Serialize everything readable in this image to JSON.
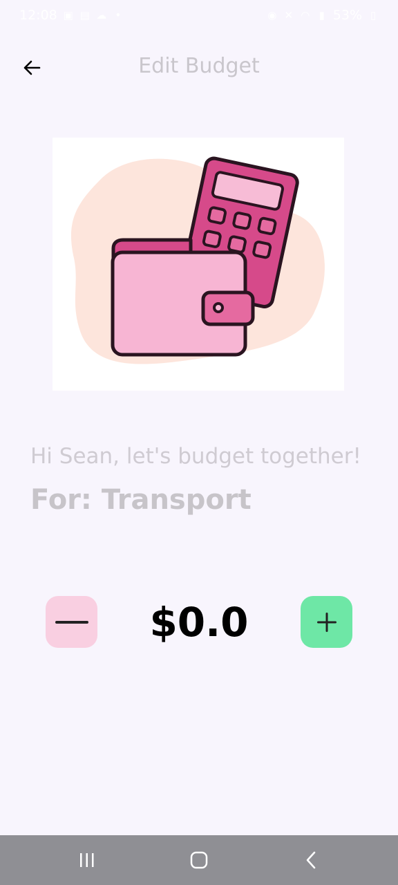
{
  "status_bar": {
    "time": "12:08",
    "battery": "53%",
    "left_icons": [
      "image-icon",
      "gallery-icon",
      "cloud-icon",
      "dot-icon"
    ],
    "right_icons": [
      "alarm-icon",
      "mute-icon",
      "wifi-icon",
      "signal-icon",
      "battery-icon"
    ]
  },
  "header": {
    "title": "Edit Budget",
    "back_icon": "arrow-left-icon"
  },
  "illustration": {
    "subject": "wallet-and-calculator",
    "colors": {
      "blob": "#fde5dc",
      "wallet": "#f7b5d3",
      "calculator": "#d64a8a",
      "outline": "#2a1420"
    }
  },
  "greeting": "Hi Sean, let's budget together!",
  "category_label": "For: Transport",
  "stepper": {
    "amount": "$0.0",
    "minus_icon": "minus-icon",
    "plus_icon": "plus-icon",
    "minus_color": "#f9cfe1",
    "plus_color": "#6ee7a6"
  },
  "nav_bar": {
    "items": [
      "recent-apps-icon",
      "home-icon",
      "back-icon"
    ]
  }
}
